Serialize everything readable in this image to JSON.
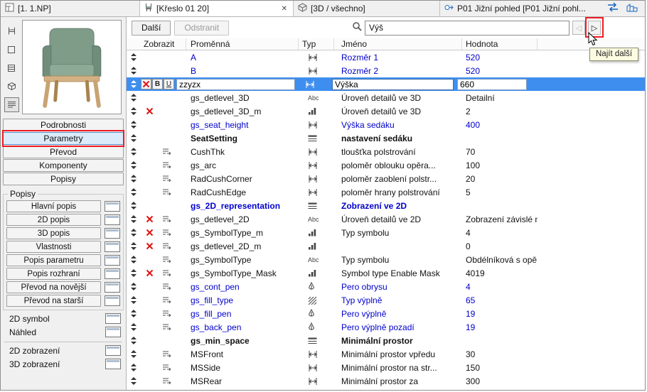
{
  "tabbar": {
    "tabs": [
      {
        "label": "[1. 1.NP]",
        "icon": "floorplan-icon",
        "active": false
      },
      {
        "label": "[Křeslo 01 20]",
        "icon": "object-icon",
        "active": true,
        "close_glyph": "✕"
      },
      {
        "label": "[3D / všechno]",
        "icon": "3d-icon",
        "active": false
      },
      {
        "label": "P01 Jižní pohled [P01 Jižní pohl...",
        "icon": "elevation-icon",
        "active": false
      }
    ]
  },
  "sidebar": {
    "preview_tools": [
      {
        "icon": "chair"
      },
      {
        "icon": "square"
      },
      {
        "icon": "hatch"
      },
      {
        "icon": "cube"
      },
      {
        "icon": "list",
        "pressed": true
      }
    ],
    "nav_buttons": [
      {
        "label": "Podrobnosti",
        "active": false
      },
      {
        "label": "Parametry",
        "active": true,
        "annotated": true
      },
      {
        "label": "Převod",
        "active": false
      },
      {
        "label": "Komponenty",
        "active": false
      },
      {
        "label": "Popisy",
        "active": false
      }
    ],
    "group_title": "Popisy",
    "group_items": [
      "Hlavní popis",
      "2D popis",
      "3D popis",
      "Vlastnosti",
      "Popis parametru",
      "Popis rozhraní",
      "Převod na novější",
      "Převod na starší"
    ],
    "preview_items": [
      "2D symbol",
      "Náhled"
    ],
    "display_items": [
      "2D zobrazení",
      "3D zobrazení"
    ]
  },
  "toolbar": {
    "next_button": "Další",
    "remove_button": "Odstranit",
    "search_value": "Výš",
    "find_prev": "◁",
    "find_next": "▷",
    "tooltip": "Najít další"
  },
  "type_icons": {
    "text_label": "Abc"
  },
  "table": {
    "headers": [
      "Zobrazit",
      "Proměnná",
      "Typ",
      "Jméno",
      "Hodnota"
    ],
    "selected_tools": {
      "bold": "B",
      "underline": "U"
    },
    "rows": [
      {
        "variable": "A",
        "type": "length",
        "name": "Rozměr 1",
        "value": "520",
        "link": true
      },
      {
        "variable": "B",
        "type": "length",
        "name": "Rozměr 2",
        "value": "520",
        "link": true
      },
      {
        "variable": "zzyzx",
        "type": "length",
        "name": "Výška",
        "value": "660",
        "hidden_x": true,
        "selected": true
      },
      {
        "variable": "gs_detlevel_3D",
        "type": "text",
        "name": "Úroveň detailů ve 3D",
        "value": "Detailní"
      },
      {
        "variable": "gs_detlevel_3D_m",
        "type": "int",
        "name": "Úroveň detailů ve 3D",
        "value": "2",
        "hidden_x": true
      },
      {
        "variable": "gs_seat_height",
        "type": "length",
        "name": "Výška sedáku",
        "value": "400",
        "link": true
      },
      {
        "variable": "SeatSetting",
        "type": "title",
        "name": "nastavení sedáku",
        "value": "",
        "bold": true
      },
      {
        "variable": "CushThk",
        "type": "length",
        "name": "tloušťka polstrování",
        "value": "70",
        "indent": true
      },
      {
        "variable": "gs_arc",
        "type": "length",
        "name": "poloměr oblouku opěra...",
        "value": "100",
        "indent": true
      },
      {
        "variable": "RadCushCorner",
        "type": "length",
        "name": "poloměr zaoblení polstr...",
        "value": "20",
        "indent": true
      },
      {
        "variable": "RadCushEdge",
        "type": "length",
        "name": "poloměr hrany polstrování",
        "value": "5",
        "indent": true
      },
      {
        "variable": "gs_2D_representation",
        "type": "title",
        "name": "Zobrazení ve 2D",
        "value": "",
        "bold": true,
        "link": true
      },
      {
        "variable": "gs_detlevel_2D",
        "type": "text",
        "name": "Úroveň detailů ve 2D",
        "value": "Zobrazení závislé n...",
        "hidden_x": true,
        "indent": true
      },
      {
        "variable": "gs_SymbolType_m",
        "type": "int",
        "name": "Typ symbolu",
        "value": "4",
        "hidden_x": true,
        "indent": true
      },
      {
        "variable": "gs_detlevel_2D_m",
        "type": "int",
        "name": "",
        "value": "0",
        "hidden_x": true,
        "indent": true
      },
      {
        "variable": "gs_SymbolType",
        "type": "text",
        "name": "Typ symbolu",
        "value": "Obdélníková s opě...",
        "indent": true
      },
      {
        "variable": "gs_SymbolType_Mask",
        "type": "int",
        "name": "Symbol type Enable Mask",
        "value": "4019",
        "hidden_x": true,
        "indent": true
      },
      {
        "variable": "gs_cont_pen",
        "type": "pen",
        "name": "Pero obrysu",
        "value": "4",
        "link": true,
        "indent": true
      },
      {
        "variable": "gs_fill_type",
        "type": "fill",
        "name": "Typ výplně",
        "value": "65",
        "link": true,
        "indent": true
      },
      {
        "variable": "gs_fill_pen",
        "type": "pen",
        "name": "Pero výplně",
        "value": "19",
        "link": true,
        "indent": true
      },
      {
        "variable": "gs_back_pen",
        "type": "pen",
        "name": "Pero výplně pozadí",
        "value": "19",
        "link": true,
        "indent": true
      },
      {
        "variable": "gs_min_space",
        "type": "title",
        "name": "Minimální prostor",
        "value": "",
        "bold": true
      },
      {
        "variable": "MSFront",
        "type": "length",
        "name": "Minimální prostor vpředu",
        "value": "30",
        "indent": true
      },
      {
        "variable": "MSSide",
        "type": "length",
        "name": "Minimální prostor na str...",
        "value": "150",
        "indent": true
      },
      {
        "variable": "MSRear",
        "type": "length",
        "name": "Minimální prostor za",
        "value": "300",
        "indent": true
      }
    ]
  },
  "colors": {
    "selection_blue": "#3e8ef0",
    "link_blue": "#0000cc",
    "annotation_red": "#ed1c24",
    "tab_active_bg": "#ffffff"
  }
}
